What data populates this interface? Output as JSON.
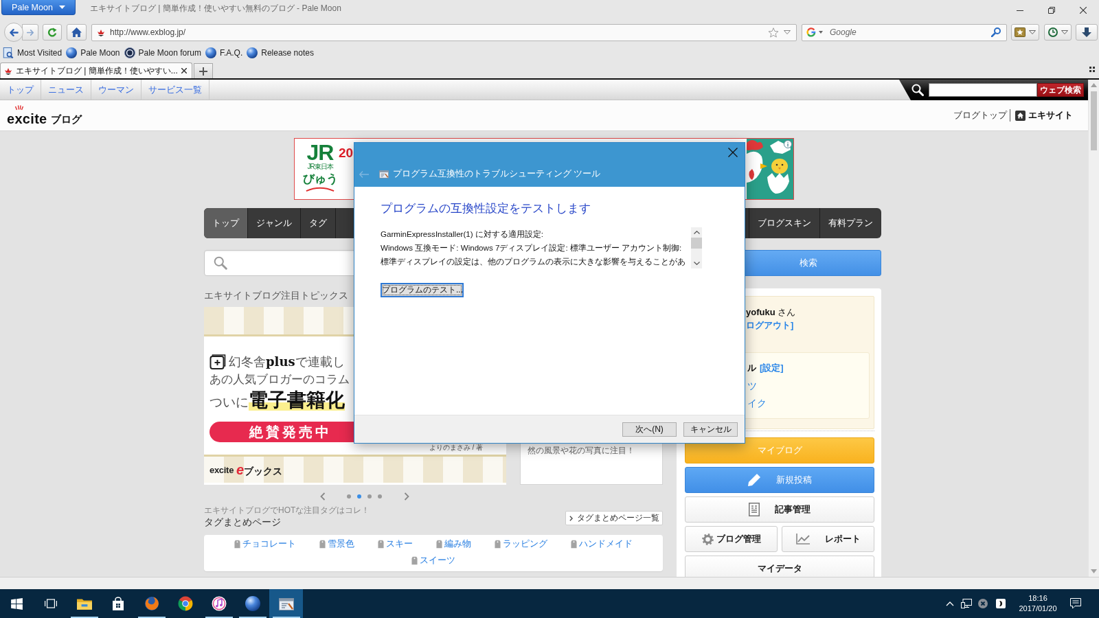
{
  "browser": {
    "menu_button": "Pale Moon",
    "title": "エキサイトブログ | 簡単作成！使いやすい無料のブログ - Pale Moon",
    "url": "http://www.exblog.jp/",
    "search": {
      "placeholder": "Google"
    },
    "bookmarks": [
      {
        "label": "Most Visited",
        "kind": "folder"
      },
      {
        "label": "Pale Moon",
        "kind": "globe"
      },
      {
        "label": "Pale Moon forum",
        "kind": "forum"
      },
      {
        "label": "F.A.Q.",
        "kind": "globe"
      },
      {
        "label": "Release notes",
        "kind": "globe"
      }
    ],
    "tabs": [
      {
        "title": "エキサイトブログ | 簡単作成！使いやすい...",
        "selected": true
      }
    ]
  },
  "site": {
    "top_links": [
      "トップ",
      "ニュース",
      "ウーマン",
      "サービス一覧"
    ],
    "web_search_button": "ウェブ検索",
    "logo": {
      "word": "excite",
      "suffix": "ブログ"
    },
    "header_links": [
      {
        "label": "ブログトップ",
        "kind": "plain"
      },
      {
        "label": "エキサイト",
        "kind": "home"
      }
    ],
    "ad": {
      "logo": "JR",
      "caption": "JR東日本",
      "brand": "びゅう",
      "headline": "20"
    },
    "nav_tabs_start": [
      {
        "label": "トップ",
        "selected": true
      },
      {
        "label": "ジャンル",
        "selected": false
      },
      {
        "label": "タグ",
        "selected": false
      }
    ],
    "nav_tabs_end": [
      {
        "label": "ブログスキン",
        "selected": false
      },
      {
        "label": "有料プラン",
        "selected": false
      }
    ],
    "search_button": "検索",
    "topics": {
      "heading": "エキサイトブログ注目トピックス",
      "slide": {
        "line_1": "幻冬舎**plus**で連載し",
        "line_2": "あの人気ブロガーのコラム",
        "line_3": "ついに**電子書籍化**",
        "cta": "絶賛発売中",
        "author": "よりのまさみ / 著",
        "footer_logo": "excite",
        "footer_brand": "eブックス"
      },
      "next_card": "然の風景や花の写真に注目！",
      "dots": [
        {
          "selected": false
        },
        {
          "selected": true
        },
        {
          "selected": false
        },
        {
          "selected": false
        }
      ]
    },
    "tags": {
      "note": "エキサイトブログでHOTな注目タグはコレ！",
      "heading": "タグまとめページ",
      "list_button": "タグまとめページ一覧",
      "items": [
        "チョコレート",
        "雪景色",
        "スキー",
        "編み物",
        "ラッピング",
        "ハンドメイド",
        "スイーツ"
      ]
    },
    "user_panel": {
      "greeting": "**yofuku** さん",
      "logout": "ログアウト]",
      "genre_label": "ル",
      "genre_setting": "[設定]",
      "genres": [
        "ツ",
        "イク"
      ],
      "buttons": [
        {
          "label": "マイブログ",
          "kind": "myblog"
        },
        {
          "label": "新規投稿",
          "kind": "post"
        },
        {
          "label": "記事管理",
          "kind": "articles"
        },
        {
          "label": "ブログ管理",
          "kind": "settings"
        },
        {
          "label": "レポート",
          "kind": "report"
        },
        {
          "label": "マイデータ",
          "kind": "mydata"
        }
      ]
    }
  },
  "dialog": {
    "title": "プログラム互換性のトラブルシューティング ツール",
    "back_button": {
      "disabled": true
    },
    "heading": "プログラムの互換性設定をテストします",
    "details": [
      "GarminExpressInstaller(1) に対する適用設定:",
      "Windows 互換モード: Windows 7ディスプレイ設定: 標準ユーザー アカウント制御:",
      "標準ディスプレイの設定は、他のプログラムの表示に大きな影響を与えることがあ"
    ],
    "test_button": {
      "label": "プログラムのテスト...",
      "focused": true
    },
    "buttons": [
      "次へ(N)",
      "キャンセル"
    ]
  },
  "taskbar": {
    "apps": [
      {
        "kind": "start",
        "running": false,
        "selected": false
      },
      {
        "kind": "taskview",
        "running": false,
        "selected": false
      },
      {
        "kind": "explorer",
        "running": true,
        "selected": false
      },
      {
        "kind": "store",
        "running": false,
        "selected": false
      },
      {
        "kind": "firefox",
        "running": true,
        "selected": false
      },
      {
        "kind": "chrome",
        "running": false,
        "selected": false
      },
      {
        "kind": "itunes",
        "running": true,
        "selected": false
      },
      {
        "kind": "palemoon",
        "running": true,
        "selected": false
      },
      {
        "kind": "troubleshooter",
        "running": true,
        "selected": true
      }
    ],
    "clock": {
      "time": "18:16",
      "date": "2017/01/20"
    }
  }
}
